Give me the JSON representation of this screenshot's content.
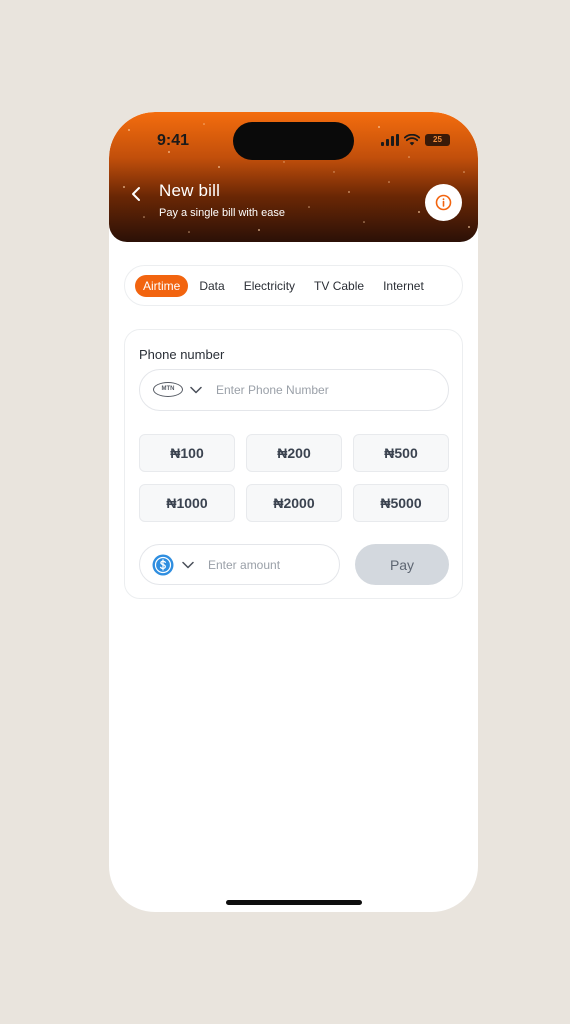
{
  "status_bar": {
    "time": "9:41",
    "battery": "25"
  },
  "header": {
    "title": "New bill",
    "subtitle": "Pay a single bill with ease"
  },
  "tabs": [
    {
      "label": "Airtime",
      "active": true
    },
    {
      "label": "Data",
      "active": false
    },
    {
      "label": "Electricity",
      "active": false
    },
    {
      "label": "TV Cable",
      "active": false
    },
    {
      "label": "Internet",
      "active": false
    }
  ],
  "form": {
    "phone_label": "Phone number",
    "network": "MTN",
    "phone_placeholder": "Enter Phone Number",
    "amount_options": [
      "₦100",
      "₦200",
      "₦500",
      "₦1000",
      "₦2000",
      "₦5000"
    ],
    "amount_placeholder": "Enter amount",
    "pay_label": "Pay"
  },
  "icons": {
    "back": "chevron-left-icon",
    "info": "info-circle-icon",
    "network_dropdown": "chevron-down-icon",
    "currency": "dollar-coin-icon"
  },
  "colors": {
    "accent": "#f2640f",
    "header_top": "#f46d0e",
    "header_bottom": "#2b1006",
    "pay_disabled": "#d3d8de",
    "background": "#e9e4dd"
  }
}
